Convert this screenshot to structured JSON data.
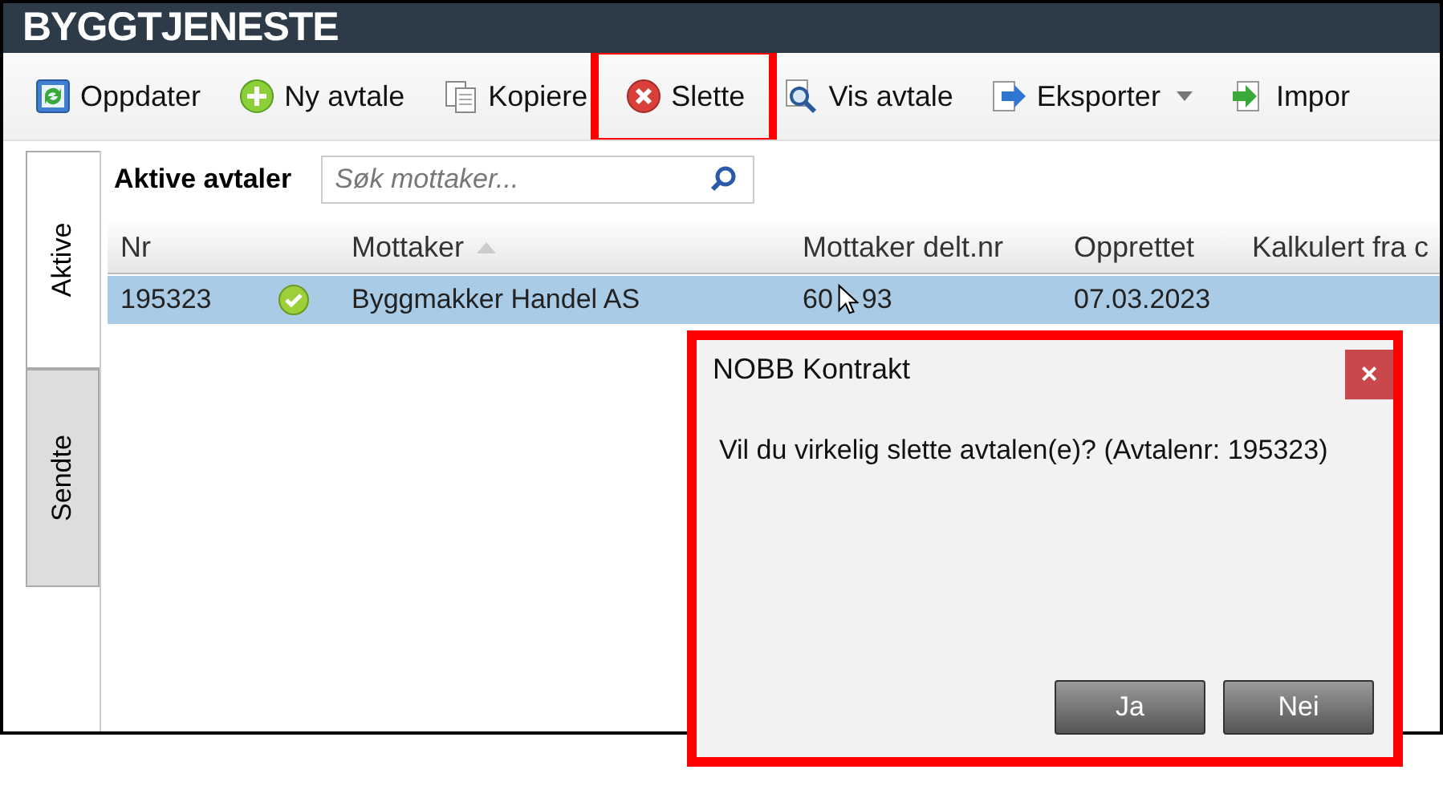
{
  "app_title": "BYGGTJENESTE",
  "toolbar": [
    {
      "kind": "refresh",
      "label": "Oppdater",
      "highlighted": false,
      "dropdown": false
    },
    {
      "kind": "add",
      "label": "Ny avtale",
      "highlighted": false,
      "dropdown": false
    },
    {
      "kind": "copy",
      "label": "Kopiere",
      "highlighted": false,
      "dropdown": false
    },
    {
      "kind": "delete",
      "label": "Slette",
      "highlighted": true,
      "dropdown": false
    },
    {
      "kind": "view",
      "label": "Vis avtale",
      "highlighted": false,
      "dropdown": false
    },
    {
      "kind": "export",
      "label": "Eksporter",
      "highlighted": false,
      "dropdown": true
    },
    {
      "kind": "import",
      "label": "Impor",
      "highlighted": false,
      "dropdown": false
    }
  ],
  "side_tabs": [
    {
      "label": "Aktive",
      "selected": true
    },
    {
      "label": "Sendte",
      "selected": false
    }
  ],
  "panel_title": "Aktive avtaler",
  "search": {
    "placeholder": "Søk mottaker..."
  },
  "table": {
    "columns": [
      {
        "label": "Nr",
        "sorted": false
      },
      {
        "label": "Mottaker",
        "sorted": true
      },
      {
        "label": "Mottaker delt.nr",
        "sorted": false
      },
      {
        "label": "Opprettet",
        "sorted": false
      },
      {
        "label": "Kalkulert fra c",
        "sorted": false
      }
    ],
    "rows": [
      {
        "selected": true,
        "active": true,
        "cells": [
          "195323",
          "Byggmakker Handel AS",
          "60 93",
          "07.03.2023"
        ]
      }
    ]
  },
  "dialog": {
    "title": "NOBB Kontrakt",
    "close": "×",
    "message": "Vil du virkelig slette avtalen(e)? (Avtalenr: 195323)",
    "buttons": [
      "Ja",
      "Nei"
    ],
    "highlighted": true
  }
}
